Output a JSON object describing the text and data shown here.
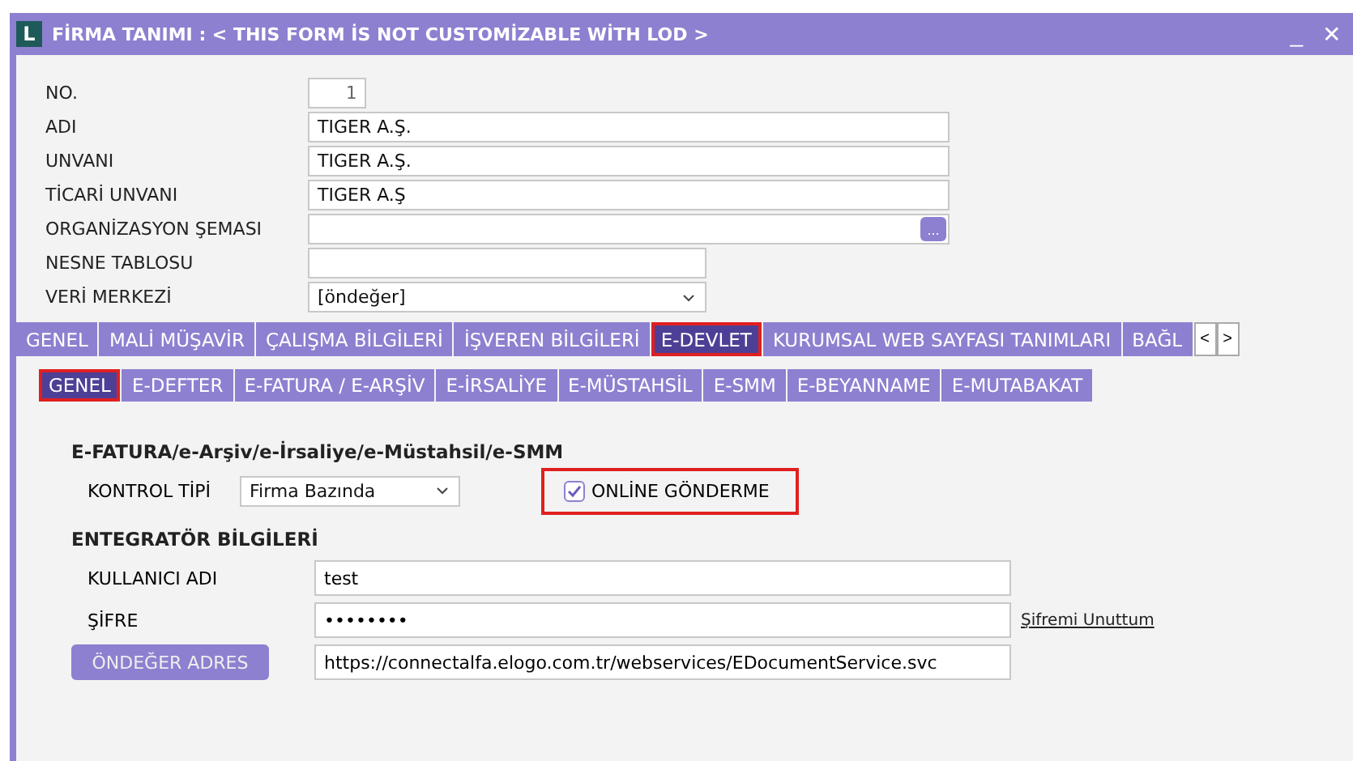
{
  "window": {
    "title": "FİRMA TANIMI : < THIS FORM İS NOT CUSTOMİZABLE WİTH LOD >",
    "logo": "L",
    "minimize": "_",
    "close": "✕"
  },
  "fields": [
    {
      "label": "NO.",
      "value": "1",
      "kind": "number"
    },
    {
      "label": "ADI",
      "value": "TIGER A.Ş.",
      "kind": "text"
    },
    {
      "label": "UNVANI",
      "value": "TIGER A.Ş.",
      "kind": "text"
    },
    {
      "label": "TİCARİ UNVANI",
      "value": "TIGER A.Ş",
      "kind": "text"
    },
    {
      "label": "ORGANİZASYON ŞEMASI",
      "kind": "lookup",
      "button": "..."
    },
    {
      "label": "NESNE TABLOSU",
      "kind": "short"
    },
    {
      "label": "VERİ MERKEZİ",
      "value": "[öndeğer]",
      "kind": "select"
    }
  ],
  "tabs": [
    {
      "label": "GENEL",
      "selected": false,
      "highlighted": false
    },
    {
      "label": "MALİ MÜŞAVİR",
      "selected": false,
      "highlighted": false
    },
    {
      "label": "ÇALIŞMA BİLGİLERİ",
      "selected": false,
      "highlighted": false
    },
    {
      "label": "İŞVEREN BİLGİLERİ",
      "selected": false,
      "highlighted": false
    },
    {
      "label": "E-DEVLET",
      "selected": true,
      "highlighted": true
    },
    {
      "label": "KURUMSAL WEB SAYFASI TANIMLARI",
      "selected": false,
      "highlighted": false
    },
    {
      "label": "BAĞL",
      "selected": false,
      "highlighted": false
    }
  ],
  "tab_scroll": {
    "left": "<",
    "right": ">"
  },
  "subtabs": [
    {
      "label": "GENEL",
      "selected": true,
      "highlighted": true
    },
    {
      "label": "E-DEFTER",
      "selected": false,
      "highlighted": false
    },
    {
      "label": "E-FATURA / E-ARŞİV",
      "selected": false,
      "highlighted": false
    },
    {
      "label": "E-İRSALİYE",
      "selected": false,
      "highlighted": false
    },
    {
      "label": "E-MÜSTAHSİL",
      "selected": false,
      "highlighted": false
    },
    {
      "label": "E-SMM",
      "selected": false,
      "highlighted": false
    },
    {
      "label": "E-BEYANNAME",
      "selected": false,
      "highlighted": false
    },
    {
      "label": "E-MUTABAKAT",
      "selected": false,
      "highlighted": false
    }
  ],
  "efatura": {
    "heading": "E-FATURA/e-Arşiv/e-İrsaliye/e-Müstahsil/e-SMM",
    "control_label": "KONTROL TİPİ",
    "control_value": "Firma Bazında",
    "online": {
      "label": "ONLİNE GÖNDERME",
      "checked": true,
      "highlighted": true
    }
  },
  "integrator": {
    "heading": "ENTEGRATÖR BİLGİLERİ",
    "username_label": "KULLANICI ADI",
    "username": "test",
    "password_label": "ŞİFRE",
    "password": "••••••••",
    "forgot_link": "Şifremi Unuttum",
    "default_button": "ÖNDEĞER ADRES",
    "address": "https://connectalfa.elogo.com.tr/webservices/EDocumentService.svc"
  }
}
